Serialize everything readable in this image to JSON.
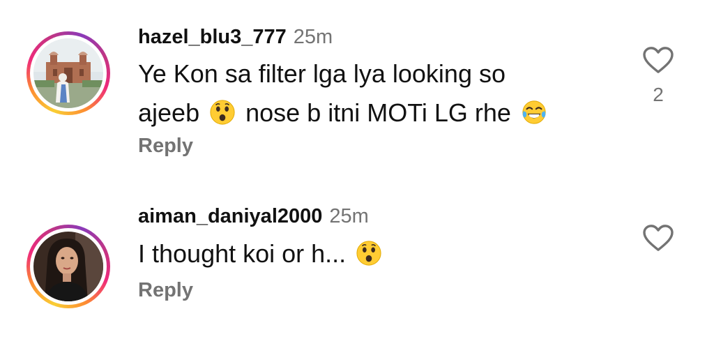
{
  "comments": [
    {
      "username": "hazel_blu3_777",
      "time": "25m",
      "line1": "Ye Kon sa filter lga lya looking so",
      "line2_a": "ajeeb",
      "line2_b": "nose b itni MOTi LG rhe",
      "emojis": [
        "surprised-face-emoji",
        "tears-of-joy-emoji"
      ],
      "reply_label": "Reply",
      "like_count": "2",
      "like_icon": "heart-outline-icon"
    },
    {
      "username": "aiman_daniyal2000",
      "time": "25m",
      "line1": "I thought koi or h...",
      "emojis": [
        "surprised-face-emoji"
      ],
      "reply_label": "Reply",
      "like_icon": "heart-outline-icon"
    }
  ],
  "colors": {
    "text": "#111111",
    "secondary": "#737373",
    "ring_gradient": [
      "#f9ce34",
      "#ee2a7b",
      "#6228d7"
    ]
  }
}
